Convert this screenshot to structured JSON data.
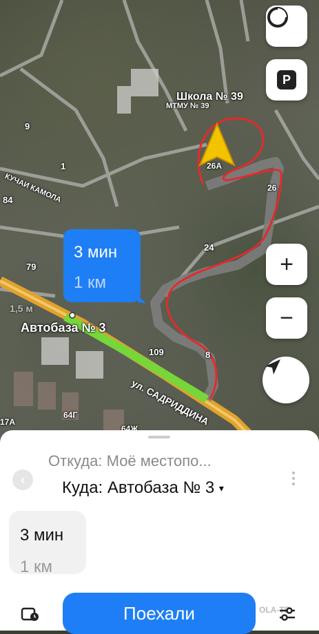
{
  "map": {
    "labels": {
      "school": "Школа № 39",
      "school_sub": "МТМУ № 39",
      "n9": "9",
      "n1": "1",
      "n84": "84",
      "n79": "79",
      "street_kuchaikamola": "КУЧАИ КАМОЛА",
      "n26a": "26А",
      "n26": "26",
      "n24": "24",
      "n109": "109",
      "n8": "8",
      "n64g": "64Г",
      "n17a": "17А",
      "n64j": "64Ж",
      "street_sadriddina": "ул. САДРИДДИНА",
      "destination": "Автобаза № 3",
      "distance_overlay": "1,5 м"
    },
    "route_bubble": {
      "time": "3 мин",
      "distance": "1 км"
    },
    "controls": {
      "layers_icon": "layers-icon",
      "parking": "P",
      "zoom_in": "+",
      "zoom_out": "−",
      "locate_icon": "navigation-arrow-icon"
    },
    "colors": {
      "route": "#7a7a7a",
      "route_green": "#76d63a",
      "annotation": "#e32b2b",
      "accent": "#1e7ef5",
      "road_orange": "#e0a22e"
    }
  },
  "sheet": {
    "from": "Откуда: Моё местопо...",
    "to": "Куда: Автобаза № 3",
    "to_arrow": "▾",
    "option_time": "3 мин",
    "option_distance": "1 км",
    "go_button": "Поехали",
    "watermark": "OLA-TE"
  }
}
